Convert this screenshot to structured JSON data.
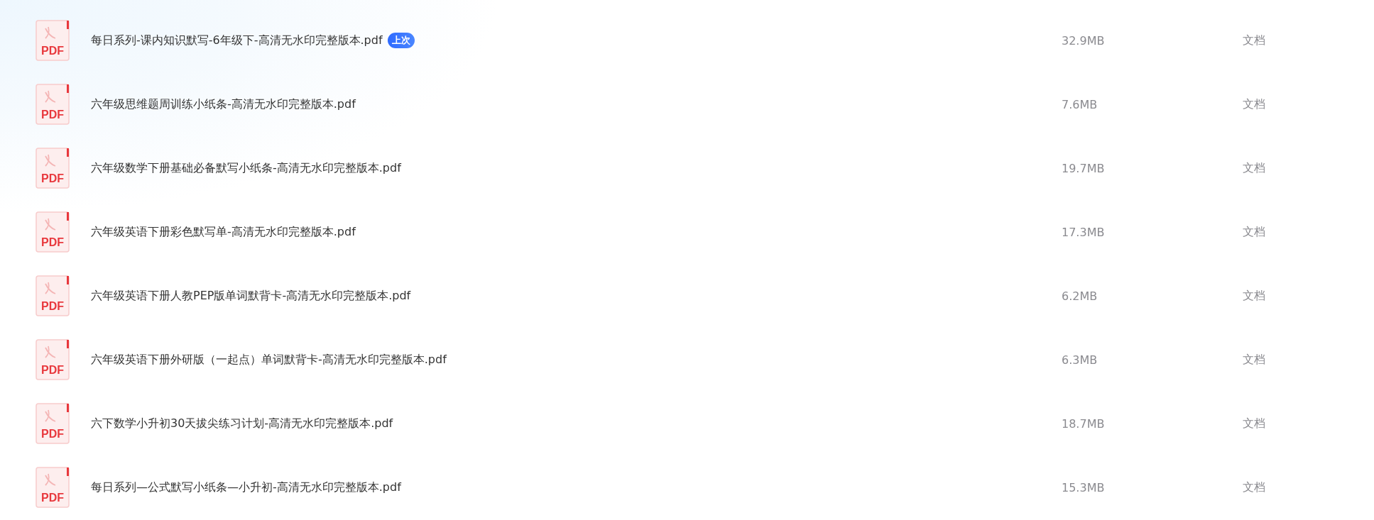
{
  "files": [
    {
      "icon_label": "PDF",
      "name": "每日系列-课内知识默写-6年级下-高清无水印完整版本.pdf",
      "badge": "上次",
      "size": "32.9MB",
      "type": "文档"
    },
    {
      "icon_label": "PDF",
      "name": "六年级思维题周训练小纸条-高清无水印完整版本.pdf",
      "size": "7.6MB",
      "type": "文档"
    },
    {
      "icon_label": "PDF",
      "name": "六年级数学下册基础必备默写小纸条-高清无水印完整版本.pdf",
      "size": "19.7MB",
      "type": "文档"
    },
    {
      "icon_label": "PDF",
      "name": "六年级英语下册彩色默写单-高清无水印完整版本.pdf",
      "size": "17.3MB",
      "type": "文档"
    },
    {
      "icon_label": "PDF",
      "name": "六年级英语下册人教PEP版单词默背卡-高清无水印完整版本.pdf",
      "size": "6.2MB",
      "type": "文档"
    },
    {
      "icon_label": "PDF",
      "name": "六年级英语下册外研版（一起点）单词默背卡-高清无水印完整版本.pdf",
      "size": "6.3MB",
      "type": "文档"
    },
    {
      "icon_label": "PDF",
      "name": "六下数学小升初30天拔尖练习计划-高清无水印完整版本.pdf",
      "size": "18.7MB",
      "type": "文档"
    },
    {
      "icon_label": "PDF",
      "name": "每日系列—公式默写小纸条—小升初-高清无水印完整版本.pdf",
      "size": "15.3MB",
      "type": "文档"
    }
  ]
}
